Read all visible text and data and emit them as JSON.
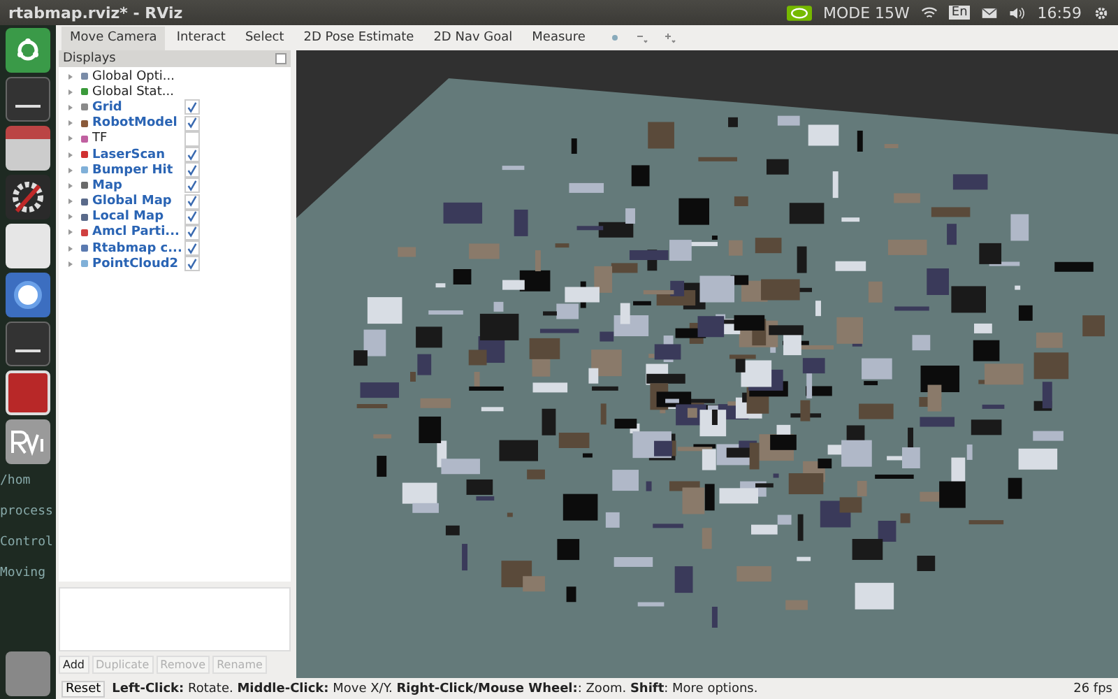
{
  "top_bar": {
    "title": "rtabmap.rviz* - RViz",
    "mode": "MODE 15W",
    "keyboard": "En",
    "time": "16:59"
  },
  "launcher": {
    "terminal_text": [
      "/hom",
      "process",
      "Control",
      "Moving"
    ]
  },
  "tools": [
    {
      "label": "Move Camera",
      "selected": true
    },
    {
      "label": "Interact",
      "selected": false
    },
    {
      "label": "Select",
      "selected": false
    },
    {
      "label": "2D Pose Estimate",
      "selected": false
    },
    {
      "label": "2D Nav Goal",
      "selected": false
    },
    {
      "label": "Measure",
      "selected": false
    }
  ],
  "displays": {
    "title": "Displays",
    "items": [
      {
        "kind": "global",
        "name": "Global Opti...",
        "color": "#7a8ca8"
      },
      {
        "kind": "global",
        "name": "Global Stat...",
        "color": "#3a9a3a"
      },
      {
        "kind": "display",
        "name": "Grid",
        "checked": true,
        "color": "#8a8a8a"
      },
      {
        "kind": "display",
        "name": "RobotModel",
        "checked": true,
        "color": "#8a5a3a"
      },
      {
        "kind": "display",
        "name": "TF",
        "checked": false,
        "color": "#c060a0"
      },
      {
        "kind": "display",
        "name": "LaserScan",
        "checked": true,
        "color": "#d03030"
      },
      {
        "kind": "display",
        "name": "Bumper Hit",
        "checked": true,
        "color": "#80b0d8"
      },
      {
        "kind": "display",
        "name": "Map",
        "checked": true,
        "color": "#6a6a6a"
      },
      {
        "kind": "display",
        "name": "Global Map",
        "checked": true,
        "color": "#5a6a8a"
      },
      {
        "kind": "display",
        "name": "Local Map",
        "checked": true,
        "color": "#5a6a8a"
      },
      {
        "kind": "display",
        "name": "Amcl Parti...",
        "checked": true,
        "color": "#d04040"
      },
      {
        "kind": "display",
        "name": "Rtabmap c...",
        "checked": true,
        "color": "#5a7ab0"
      },
      {
        "kind": "display",
        "name": "PointCloud2",
        "checked": true,
        "color": "#80b0d8"
      }
    ]
  },
  "buttons": [
    {
      "label": "Add",
      "disabled": false
    },
    {
      "label": "Duplicate",
      "disabled": true
    },
    {
      "label": "Remove",
      "disabled": true
    },
    {
      "label": "Rename",
      "disabled": true
    }
  ],
  "status_bar": {
    "reset": "Reset",
    "hint": "**Left-Click:** Rotate. **Middle-Click:** Move X/Y. **Right-Click/Mouse Wheel:**: Zoom. **Shift**: More options.",
    "fps": "26 fps"
  }
}
